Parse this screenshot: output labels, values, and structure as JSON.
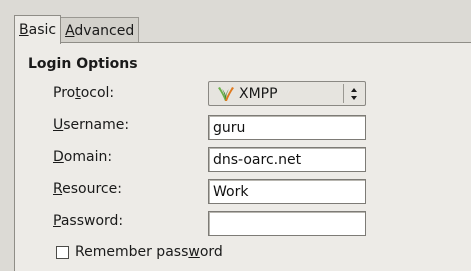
{
  "tabs": [
    {
      "label_pre": "",
      "label_mnemonic": "B",
      "label_post": "asic"
    },
    {
      "label_pre": "",
      "label_mnemonic": "A",
      "label_post": "dvanced"
    }
  ],
  "login_options": {
    "title": "Login Options",
    "protocol": {
      "label_pre": "Pro",
      "label_mnemonic": "t",
      "label_post": "ocol:",
      "value": "XMPP",
      "icon": "xmpp-logo-icon"
    },
    "username": {
      "label_pre": "",
      "label_mnemonic": "U",
      "label_post": "sername:",
      "value": "guru"
    },
    "domain": {
      "label_pre": "",
      "label_mnemonic": "D",
      "label_post": "omain:",
      "value": "dns-oarc.net"
    },
    "resource": {
      "label_pre": "",
      "label_mnemonic": "R",
      "label_post": "esource:",
      "value": "Work"
    },
    "password": {
      "label_pre": "",
      "label_mnemonic": "P",
      "label_post": "assword:",
      "value": ""
    },
    "remember_password": {
      "label_pre": "Remember pass",
      "label_mnemonic": "w",
      "label_post": "ord",
      "checked": false
    }
  },
  "colors": {
    "window_bg": "#dcdad5",
    "panel_bg": "#edebe7",
    "field_bg": "#ffffff",
    "xmpp_green": "#6ab04a",
    "xmpp_orange": "#e07a1f"
  }
}
